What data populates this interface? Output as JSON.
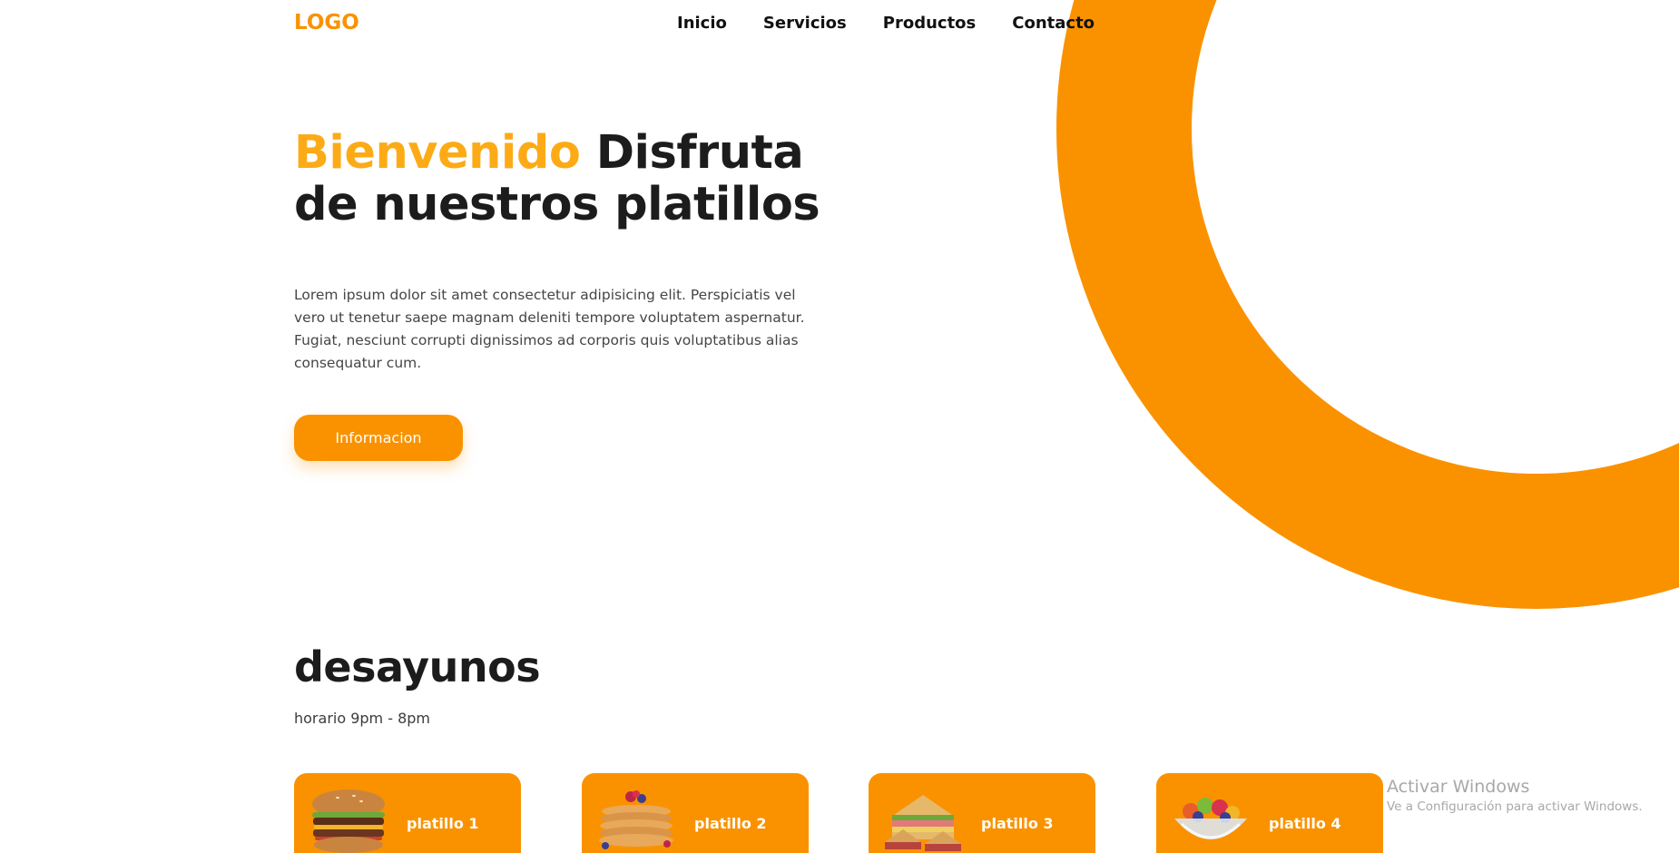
{
  "header": {
    "logo": "LOGO",
    "nav": [
      "Inicio",
      "Servicios",
      "Productos",
      "Contacto"
    ]
  },
  "hero": {
    "title_accent": "Bienvenido",
    "title_rest": "Disfruta de nuestros platillos",
    "description": "Lorem ipsum dolor sit amet consectetur adipisicing elit. Perspiciatis vel vero ut tenetur saepe magnam deleniti tempore voluptatem aspernatur. Fugiat, nesciunt corrupti dignissimos ad corporis quis voluptatibus alias consequatur cum.",
    "button_label": "Informacion"
  },
  "section": {
    "title": "desayunos",
    "schedule": "horario 9pm - 8pm",
    "cards": [
      {
        "label": "platillo 1",
        "image": "burger"
      },
      {
        "label": "platillo 2",
        "image": "pancakes"
      },
      {
        "label": "platillo 3",
        "image": "sandwich"
      },
      {
        "label": "platillo 4",
        "image": "fruit-bowl"
      }
    ]
  },
  "watermark": {
    "title": "Activar Windows",
    "subtitle": "Ve a Configuración para activar Windows."
  },
  "colors": {
    "accent": "#fa9200",
    "accent_text": "#fcab17",
    "dark_text": "#1c1c1c"
  }
}
